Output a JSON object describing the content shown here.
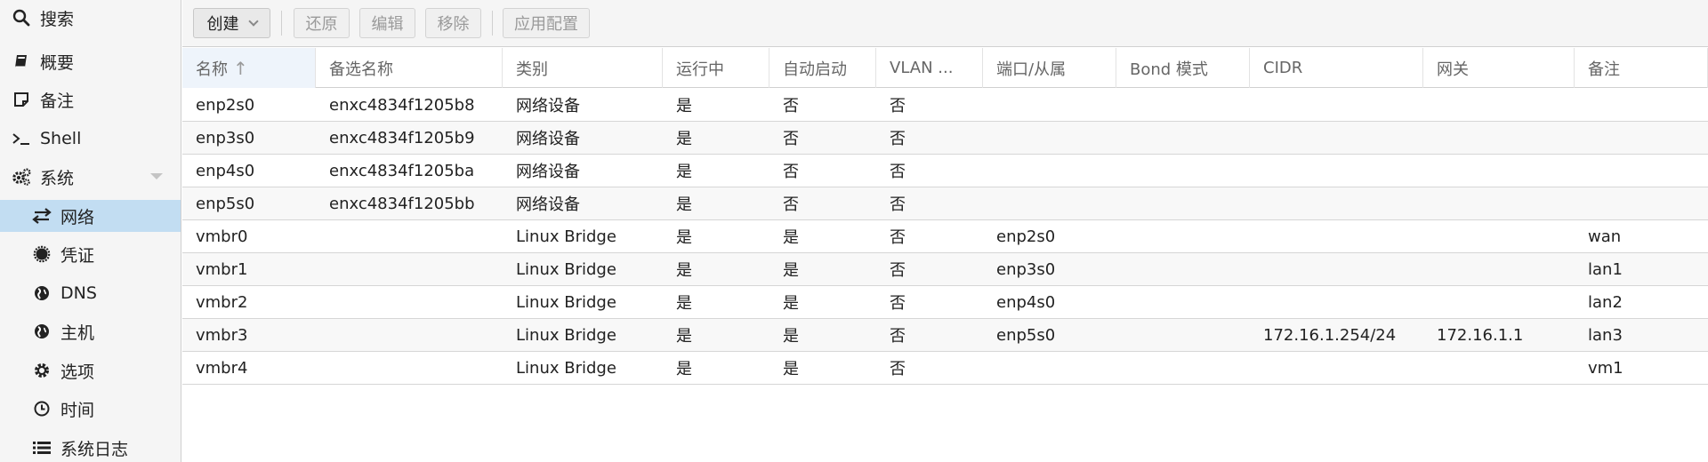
{
  "sidebar": {
    "items": [
      {
        "label": "搜索",
        "icon": "search-icon"
      },
      {
        "label": "概要",
        "icon": "book-icon"
      },
      {
        "label": "备注",
        "icon": "note-icon"
      },
      {
        "label": "Shell",
        "icon": "terminal-icon"
      },
      {
        "label": "系统",
        "icon": "cogs-icon"
      },
      {
        "label": "网络",
        "icon": "exchange-icon",
        "selected": true
      },
      {
        "label": "凭证",
        "icon": "certificate-icon"
      },
      {
        "label": "DNS",
        "icon": "globe-icon"
      },
      {
        "label": "主机",
        "icon": "globe-icon"
      },
      {
        "label": "选项",
        "icon": "gear-icon"
      },
      {
        "label": "时间",
        "icon": "clock-icon"
      },
      {
        "label": "系统日志",
        "icon": "list-icon"
      }
    ]
  },
  "toolbar": {
    "create_label": "创建",
    "revert_label": "还原",
    "edit_label": "编辑",
    "remove_label": "移除",
    "apply_label": "应用配置"
  },
  "grid": {
    "columns": [
      "名称",
      "备选名称",
      "类别",
      "运行中",
      "自动启动",
      "VLAN ...",
      "端口/从属",
      "Bond 模式",
      "CIDR",
      "网关",
      "备注"
    ],
    "sort_indicator": "↑",
    "rows": [
      [
        "enp2s0",
        "enxc4834f1205b8",
        "网络设备",
        "是",
        "否",
        "否",
        "",
        "",
        "",
        "",
        ""
      ],
      [
        "enp3s0",
        "enxc4834f1205b9",
        "网络设备",
        "是",
        "否",
        "否",
        "",
        "",
        "",
        "",
        ""
      ],
      [
        "enp4s0",
        "enxc4834f1205ba",
        "网络设备",
        "是",
        "否",
        "否",
        "",
        "",
        "",
        "",
        ""
      ],
      [
        "enp5s0",
        "enxc4834f1205bb",
        "网络设备",
        "是",
        "否",
        "否",
        "",
        "",
        "",
        "",
        ""
      ],
      [
        "vmbr0",
        "",
        "Linux Bridge",
        "是",
        "是",
        "否",
        "enp2s0",
        "",
        "",
        "",
        "wan"
      ],
      [
        "vmbr1",
        "",
        "Linux Bridge",
        "是",
        "是",
        "否",
        "enp3s0",
        "",
        "",
        "",
        "lan1"
      ],
      [
        "vmbr2",
        "",
        "Linux Bridge",
        "是",
        "是",
        "否",
        "enp4s0",
        "",
        "",
        "",
        "lan2"
      ],
      [
        "vmbr3",
        "",
        "Linux Bridge",
        "是",
        "是",
        "否",
        "enp5s0",
        "",
        "172.16.1.254/24",
        "172.16.1.1",
        "lan3"
      ],
      [
        "vmbr4",
        "",
        "Linux Bridge",
        "是",
        "是",
        "否",
        "",
        "",
        "",
        "",
        "vm1"
      ]
    ]
  },
  "colors": {
    "selected_nav_bg": "#c2ddf2",
    "sidebar_bg": "#f5f5f5",
    "row_alt_bg": "#f8f8f8"
  }
}
